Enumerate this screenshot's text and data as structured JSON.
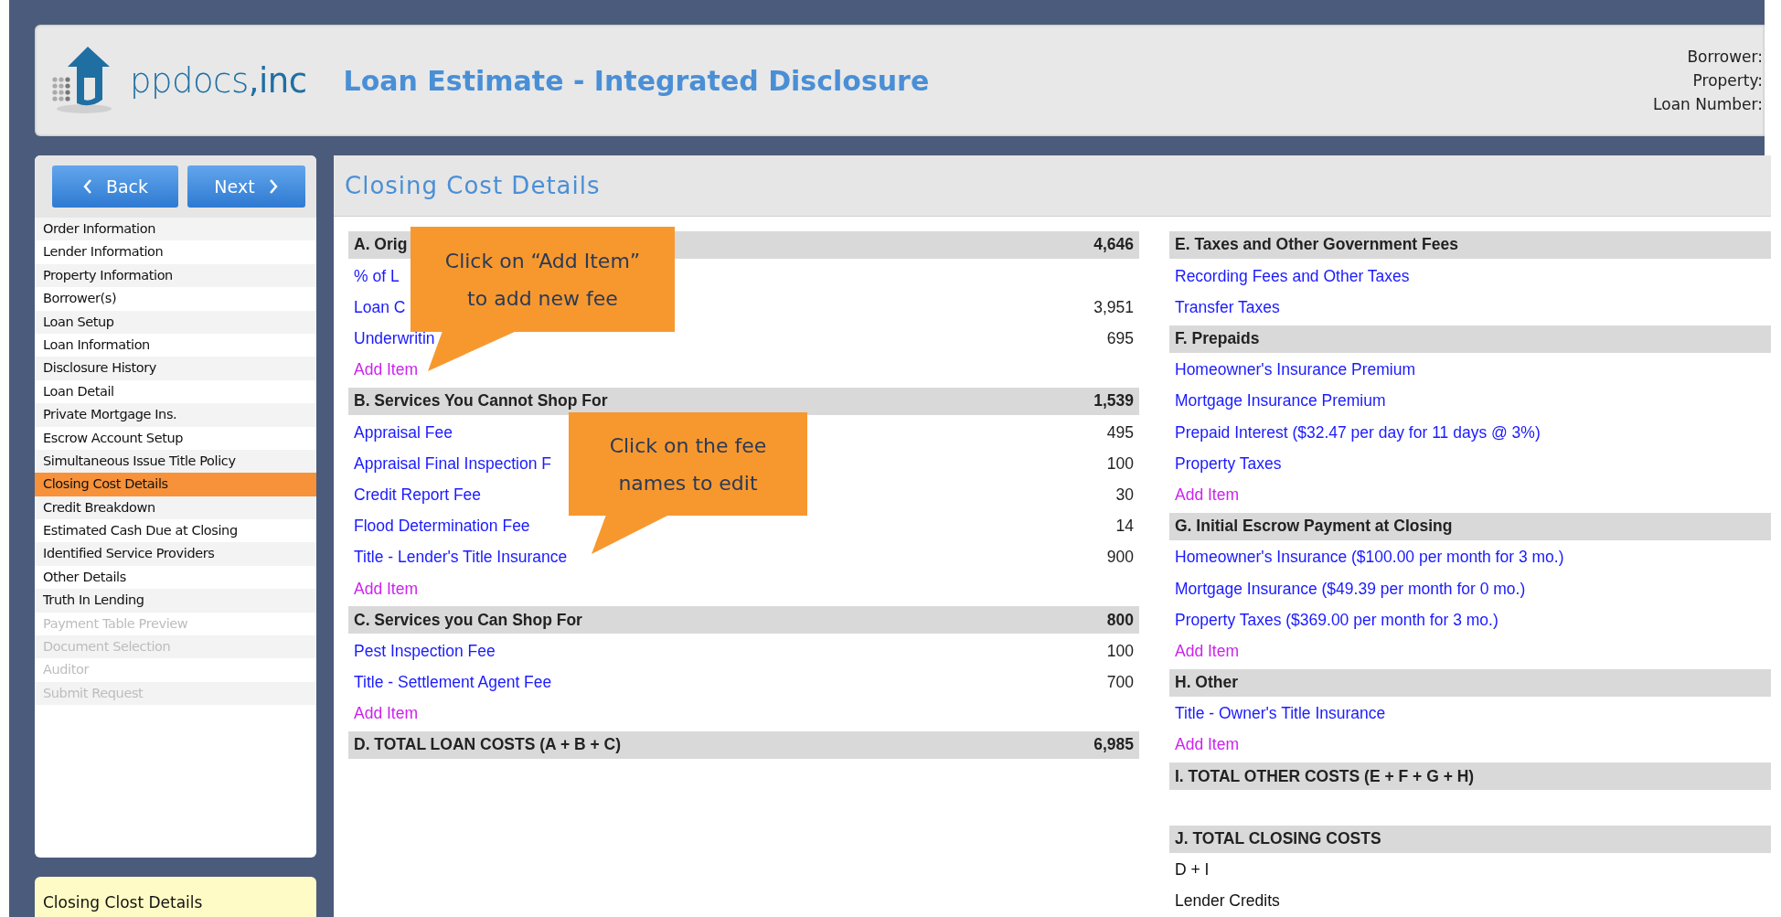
{
  "header": {
    "logo": "ppdocs**,inc**",
    "title": "Loan Estimate - Integrated Disclosure",
    "info": [
      "Borrower:",
      "Property:",
      "Loan Number:"
    ]
  },
  "nav": {
    "back": "Back",
    "next": "Next"
  },
  "sidebar": {
    "items": [
      {
        "label": "Order Information",
        "selected": false,
        "disabled": false
      },
      {
        "label": "Lender Information",
        "selected": false,
        "disabled": false
      },
      {
        "label": "Property Information",
        "selected": false,
        "disabled": false
      },
      {
        "label": "Borrower(s)",
        "selected": false,
        "disabled": false
      },
      {
        "label": "Loan Setup",
        "selected": false,
        "disabled": false
      },
      {
        "label": "Loan Information",
        "selected": false,
        "disabled": false
      },
      {
        "label": "Disclosure History",
        "selected": false,
        "disabled": false
      },
      {
        "label": "Loan Detail",
        "selected": false,
        "disabled": false
      },
      {
        "label": "Private Mortgage Ins.",
        "selected": false,
        "disabled": false
      },
      {
        "label": "Escrow Account Setup",
        "selected": false,
        "disabled": false
      },
      {
        "label": "Simultaneous Issue Title Policy",
        "selected": false,
        "disabled": false
      },
      {
        "label": "Closing Cost Details",
        "selected": true,
        "disabled": false
      },
      {
        "label": "Credit Breakdown",
        "selected": false,
        "disabled": false
      },
      {
        "label": "Estimated Cash Due at Closing",
        "selected": false,
        "disabled": false
      },
      {
        "label": "Identified Service Providers",
        "selected": false,
        "disabled": false
      },
      {
        "label": "Other Details",
        "selected": false,
        "disabled": false
      },
      {
        "label": "Truth In Lending",
        "selected": false,
        "disabled": false
      },
      {
        "label": "Payment Table Preview",
        "selected": false,
        "disabled": true
      },
      {
        "label": "Document Selection",
        "selected": false,
        "disabled": true
      },
      {
        "label": "Auditor",
        "selected": false,
        "disabled": true
      },
      {
        "label": "Submit Request",
        "selected": false,
        "disabled": true
      }
    ],
    "help": "Closing Clost Details"
  },
  "page_title": "Closing Cost Details",
  "left_table": {
    "rows": [
      {
        "kind": "header",
        "label": "A. Orig",
        "value": "4,646"
      },
      {
        "kind": "fee",
        "label": "% of L"
      },
      {
        "kind": "fee",
        "label": "Loan C",
        "value": "3,951"
      },
      {
        "kind": "fee",
        "label": "Underwritin",
        "value": "695"
      },
      {
        "kind": "add",
        "label": "Add Item"
      },
      {
        "kind": "header",
        "label": "B. Services You Cannot Shop For",
        "value": "1,539"
      },
      {
        "kind": "fee",
        "label": "Appraisal Fee",
        "value": "495"
      },
      {
        "kind": "fee",
        "label": "Appraisal Final Inspection F",
        "value": "100"
      },
      {
        "kind": "fee",
        "label": "Credit Report Fee",
        "value": "30"
      },
      {
        "kind": "fee",
        "label": "Flood Determination Fee",
        "value": "14"
      },
      {
        "kind": "fee",
        "label": "Title - Lender's Title Insurance",
        "value": "900"
      },
      {
        "kind": "add",
        "label": "Add Item"
      },
      {
        "kind": "header",
        "label": "C. Services you Can Shop For",
        "value": "800"
      },
      {
        "kind": "fee",
        "label": "Pest Inspection Fee",
        "value": "100"
      },
      {
        "kind": "fee",
        "label": "Title - Settlement Agent Fee",
        "value": "700"
      },
      {
        "kind": "add",
        "label": "Add Item"
      },
      {
        "kind": "header",
        "label": "D. TOTAL LOAN COSTS (A + B + C)",
        "value": "6,985"
      }
    ]
  },
  "right_table": {
    "rows": [
      {
        "kind": "header",
        "label": "E. Taxes and Other Government Fees"
      },
      {
        "kind": "fee",
        "label": "Recording Fees and Other Taxes"
      },
      {
        "kind": "fee",
        "label": "Transfer Taxes"
      },
      {
        "kind": "header",
        "label": "F. Prepaids"
      },
      {
        "kind": "fee",
        "label": "Homeowner's Insurance Premium"
      },
      {
        "kind": "fee",
        "label": "Mortgage Insurance Premium"
      },
      {
        "kind": "fee",
        "label": "Prepaid Interest ($32.47 per day for 11 days @ 3%)"
      },
      {
        "kind": "fee",
        "label": "Property Taxes"
      },
      {
        "kind": "add",
        "label": "Add Item"
      },
      {
        "kind": "header",
        "label": "G. Initial Escrow Payment at Closing"
      },
      {
        "kind": "fee",
        "label": "Homeowner's Insurance ($100.00 per month for 3 mo.)"
      },
      {
        "kind": "fee",
        "label": "Mortgage Insurance ($49.39 per month for 0 mo.)"
      },
      {
        "kind": "fee",
        "label": "Property Taxes ($369.00 per month for 3 mo.)"
      },
      {
        "kind": "add",
        "label": "Add Item"
      },
      {
        "kind": "header",
        "label": "H. Other"
      },
      {
        "kind": "fee",
        "label": "Title - Owner's Title Insurance"
      },
      {
        "kind": "add",
        "label": "Add Item"
      },
      {
        "kind": "header",
        "label": "I. TOTAL OTHER COSTS (E + F + G + H)"
      },
      {
        "kind": "gap"
      },
      {
        "kind": "header",
        "label": "J. TOTAL CLOSING COSTS"
      },
      {
        "kind": "plain",
        "label": "D + I"
      },
      {
        "kind": "plain",
        "label": "Lender Credits"
      }
    ]
  },
  "callouts": [
    {
      "text": "Click on “Add Item”\nto add new fee"
    },
    {
      "text": "Click on the fee\nnames to edit"
    }
  ]
}
